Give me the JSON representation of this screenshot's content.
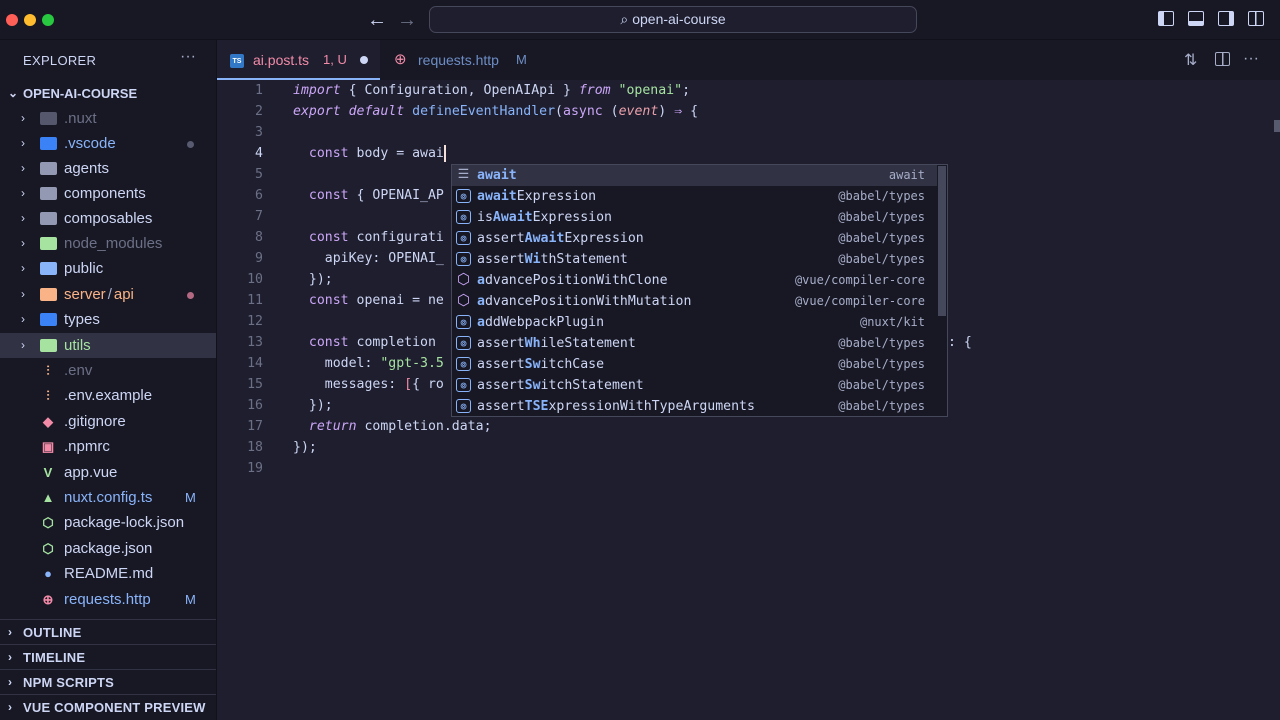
{
  "window": {
    "search_text": "open-ai-course",
    "back_icon": "←",
    "forward_icon": "→",
    "search_icon": "⌕"
  },
  "sidebar": {
    "title": "EXPLORER",
    "more": "···",
    "root": "OPEN-AI-COURSE",
    "items": [
      {
        "label": "⌄",
        "name": ".nuxt"
      },
      {
        "name": ".vscode"
      },
      {
        "name": "agents"
      },
      {
        "name": "components"
      },
      {
        "name": "composables"
      },
      {
        "name": "node_modules"
      },
      {
        "name": "public"
      },
      {
        "name": "server",
        "sep": "/",
        "sub": "api"
      },
      {
        "name": "types"
      },
      {
        "name": "utils"
      },
      {
        "name": ".env"
      },
      {
        "name": ".env.example"
      },
      {
        "name": ".gitignore"
      },
      {
        "name": ".npmrc"
      },
      {
        "name": "app.vue"
      },
      {
        "name": "nuxt.config.ts",
        "badge": "M"
      },
      {
        "name": "package-lock.json"
      },
      {
        "name": "package.json"
      },
      {
        "name": "README.md"
      },
      {
        "name": "requests.http",
        "badge": "M"
      }
    ],
    "sections": [
      "OUTLINE",
      "TIMELINE",
      "NPM SCRIPTS",
      "VUE COMPONENT PREVIEW"
    ]
  },
  "tabs": [
    {
      "icon": "TS",
      "name": "ai.post.ts",
      "status": "1, U"
    },
    {
      "name": "requests.http",
      "status": "M"
    }
  ],
  "editor": {
    "line_numbers": [
      "1",
      "2",
      "3",
      "4",
      "5",
      "6",
      "7",
      "8",
      "9",
      "10",
      "11",
      "12",
      "13",
      "14",
      "15",
      "16",
      "17",
      "18",
      "19"
    ],
    "lines": {
      "l1": {
        "a": "import",
        "b": " { Configuration, OpenAIApi } ",
        "c": "from",
        "d": " ",
        "e": "\"openai\"",
        "f": ";"
      },
      "l2": {
        "a": "export",
        "b": " ",
        "c": "default",
        "d": " ",
        "e": "defineEventHandler",
        "f": "(",
        "g": "async",
        "h": " (",
        "i": "event",
        "j": ") ",
        "k": "⇒",
        "l": " {"
      },
      "l4": {
        "a": "  const",
        "b": " body = awai"
      },
      "l5": {
        "a": "  const",
        "b": " { OPENAI_AP"
      },
      "l7": {
        "a": "  const",
        "b": " configurati"
      },
      "l8": "    apiKey: OPENAI_",
      "l9": "  });",
      "l10": {
        "a": "  const",
        "b": " openai = ne"
      },
      "l12": {
        "a": "  const",
        "b": " completion"
      },
      "l12_tail": ": {",
      "l13": {
        "a": "    model: ",
        "b": "\"gpt-3.5"
      },
      "l14": {
        "a": "    messages: ",
        "b": "[",
        "c": "{ ro"
      },
      "l15": "  });",
      "l16": {
        "a": "  return",
        "b": " completion.data;"
      },
      "l17": "});"
    }
  },
  "suggestions": [
    {
      "pre": "",
      "match": "await",
      "post": "",
      "detail": "await"
    },
    {
      "pre": "",
      "match": "await",
      "post": "Expression",
      "detail": "@babel/types"
    },
    {
      "pre": "is",
      "match": "Await",
      "post": "Expression",
      "detail": "@babel/types"
    },
    {
      "pre": "assert",
      "match": "Await",
      "post": "Expression",
      "detail": "@babel/types"
    },
    {
      "pre": "assert",
      "match": "Wi",
      "post": "thStatement",
      "detail": "@babel/types"
    },
    {
      "pre": "",
      "match": "a",
      "post": "dvancePositionWithClone",
      "detail": "@vue/compiler-core"
    },
    {
      "pre": "",
      "match": "a",
      "post": "dvancePositionWithMutation",
      "detail": "@vue/compiler-core"
    },
    {
      "pre": "",
      "match": "a",
      "post": "ddWebpackPlugin",
      "detail": "@nuxt/kit"
    },
    {
      "pre": "assert",
      "match": "Wh",
      "post": "ileStatement",
      "detail": "@babel/types"
    },
    {
      "pre": "assert",
      "match": "Sw",
      "post": "itchCase",
      "detail": "@babel/types"
    },
    {
      "pre": "assert",
      "match": "Sw",
      "post": "itchStatement",
      "detail": "@babel/types"
    },
    {
      "pre": "assert",
      "match": "TSE",
      "post": "xpressionWithTypeArguments",
      "detail": "@babel/types"
    }
  ],
  "colors": {
    "accent": "#89b4fa",
    "modified": "#f9e2af",
    "error": "#f38ba8"
  }
}
